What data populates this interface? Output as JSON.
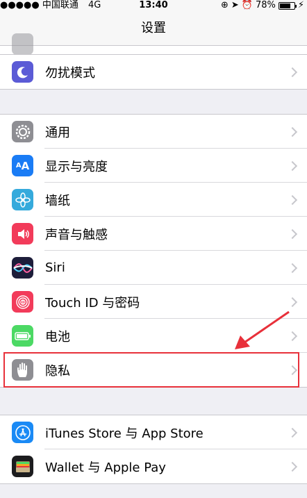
{
  "status_bar": {
    "carrier": "●●●●● 中国联通",
    "network": "4G",
    "time": "13:40",
    "battery": "78%",
    "battery_level": 0.78
  },
  "nav": {
    "title": "设置"
  },
  "groups": [
    {
      "items": [
        {
          "label": "勿扰模式",
          "icon": "moon-icon",
          "color": "#5b5bd6"
        }
      ]
    },
    {
      "items": [
        {
          "label": "通用",
          "icon": "gear-icon",
          "color": "#8e8e93"
        },
        {
          "label": "显示与亮度",
          "icon": "text-size-icon",
          "color": "#1a7cf5"
        },
        {
          "label": "墙纸",
          "icon": "flower-icon",
          "color": "#35aadc"
        },
        {
          "label": "声音与触感",
          "icon": "speaker-icon",
          "color": "#f23b5a"
        },
        {
          "label": "Siri",
          "icon": "siri-icon",
          "color": "#1d1d3a"
        },
        {
          "label": "Touch ID 与密码",
          "icon": "fingerprint-icon",
          "color": "#f23b5a"
        },
        {
          "label": "电池",
          "icon": "battery-icon",
          "color": "#4cd964"
        },
        {
          "label": "隐私",
          "icon": "hand-icon",
          "color": "#8e8e93"
        }
      ]
    },
    {
      "items": [
        {
          "label": "iTunes Store 与 App Store",
          "icon": "app-store-icon",
          "color": "#1a8af5"
        },
        {
          "label": "Wallet 与 Apple Pay",
          "icon": "wallet-icon",
          "color": "#1c1c1e"
        }
      ]
    }
  ],
  "annotation": {
    "color": "#e8303a"
  }
}
